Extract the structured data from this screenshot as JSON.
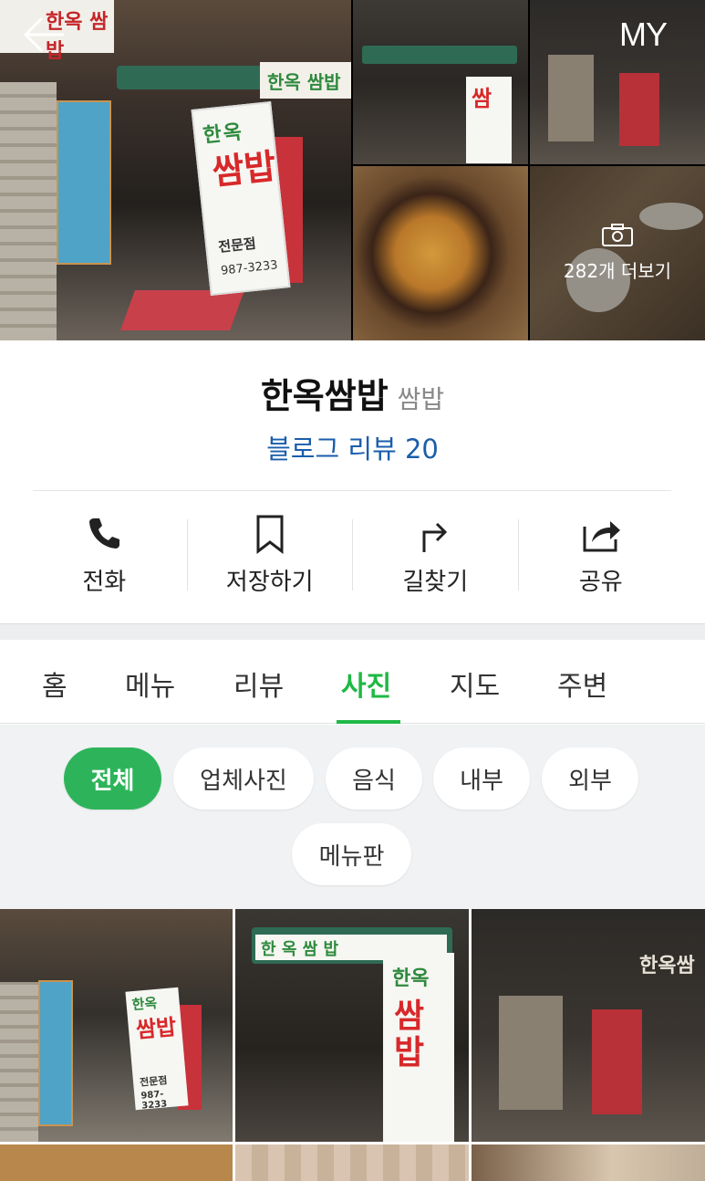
{
  "header": {
    "my_label": "MY",
    "more_photos_label": "282개 더보기"
  },
  "photo_signs": {
    "main_top": "한옥 쌈밥",
    "main_green": "한옥 쌈밥",
    "main_sign_top": "한옥",
    "main_sign_mid": "쌈밥",
    "main_sign_sub": "전문점",
    "main_sign_phone": "987-3233",
    "small_sign": "쌈"
  },
  "place": {
    "name": "한옥쌈밥",
    "category": "쌈밥",
    "blog_review": "블로그 리뷰 20"
  },
  "actions": [
    {
      "label": "전화",
      "icon": "phone-icon"
    },
    {
      "label": "저장하기",
      "icon": "bookmark-icon"
    },
    {
      "label": "길찾기",
      "icon": "directions-icon"
    },
    {
      "label": "공유",
      "icon": "share-icon"
    }
  ],
  "tabs": [
    {
      "label": "홈"
    },
    {
      "label": "메뉴"
    },
    {
      "label": "리뷰"
    },
    {
      "label": "사진",
      "active": true
    },
    {
      "label": "지도"
    },
    {
      "label": "주변"
    }
  ],
  "filters": [
    {
      "label": "전체",
      "active": true
    },
    {
      "label": "업체사진"
    },
    {
      "label": "음식"
    },
    {
      "label": "내부"
    },
    {
      "label": "외부"
    },
    {
      "label": "메뉴판"
    }
  ],
  "grid_signs": {
    "g1_top": "한옥",
    "g1_mid": "쌈밥",
    "g1_sub": "전문점",
    "g1_phone": "987-3233",
    "g2_banner": "한 옥 쌈 밥",
    "g2_top": "한옥",
    "g2_mid": "쌈밥",
    "g3_sign": "한옥쌈"
  },
  "colors": {
    "accent_green": "#1fb845",
    "chip_active": "#2db45a",
    "link_blue": "#1a5dab"
  }
}
